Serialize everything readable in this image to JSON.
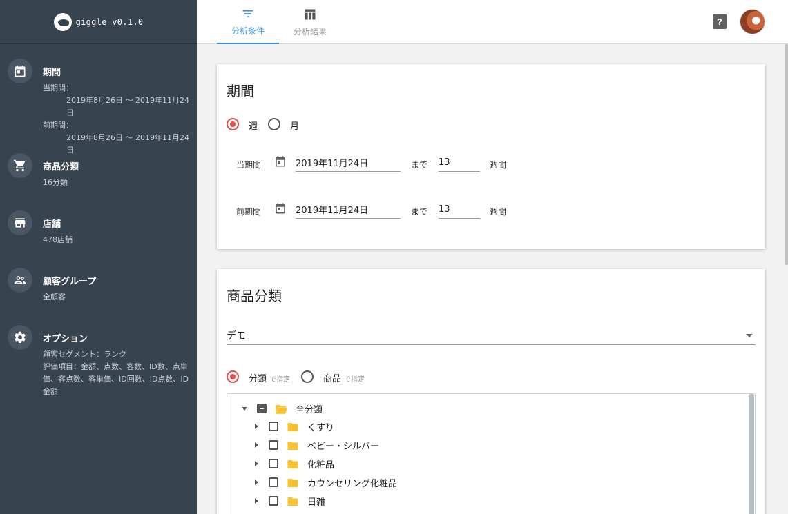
{
  "app": {
    "name": "giggle v0.1.0"
  },
  "tabs": [
    {
      "label": "分析条件",
      "icon": "filter-icon",
      "active": true
    },
    {
      "label": "分析結果",
      "icon": "table-icon",
      "active": false
    }
  ],
  "header": {
    "help": "?"
  },
  "sidebar": {
    "items": [
      {
        "title": "期間",
        "icon": "calendar-icon",
        "lines": [
          "当期間：",
          "2019年8月26日 ～ 2019年11月24日",
          "前期間：",
          "2019年8月26日 ～ 2019年11月24日"
        ]
      },
      {
        "title": "商品分類",
        "icon": "cart-icon",
        "lines": [
          "16分類"
        ]
      },
      {
        "title": "店舗",
        "icon": "store-icon",
        "lines": [
          "478店舗"
        ]
      },
      {
        "title": "顧客グループ",
        "icon": "people-icon",
        "lines": [
          "全顧客"
        ]
      },
      {
        "title": "オプション",
        "icon": "gear-icon",
        "lines": [
          "顧客セグメント：ランク",
          "評価項目：金額、点数、客数、ID数、点単",
          "価、客点数、客単価、ID回数、ID点数、ID",
          "金額"
        ]
      }
    ]
  },
  "period": {
    "title": "期間",
    "unit_options": [
      {
        "label": "週",
        "selected": true
      },
      {
        "label": "月",
        "selected": false
      }
    ],
    "current": {
      "label": "当期間",
      "date": "2019年11月24日",
      "until": "まで",
      "count": "13",
      "unit": "週間"
    },
    "previous": {
      "label": "前期間",
      "date": "2019年11月24日",
      "until": "まで",
      "count": "13",
      "unit": "週間"
    }
  },
  "category": {
    "title": "商品分類",
    "select_value": "デモ",
    "mode_options": [
      {
        "label": "分類",
        "sub": "で指定",
        "selected": true
      },
      {
        "label": "商品",
        "sub": "で指定",
        "selected": false
      }
    ],
    "tree": {
      "root": "全分類",
      "children": [
        "くすり",
        "ベビー・シルバー",
        "化粧品",
        "カウンセリング化粧品",
        "日雑"
      ]
    }
  },
  "colors": {
    "sidebar": "#37434f",
    "accent": "#3d8fe0",
    "radio": "#e84a4a",
    "folder": "#f7c232"
  }
}
